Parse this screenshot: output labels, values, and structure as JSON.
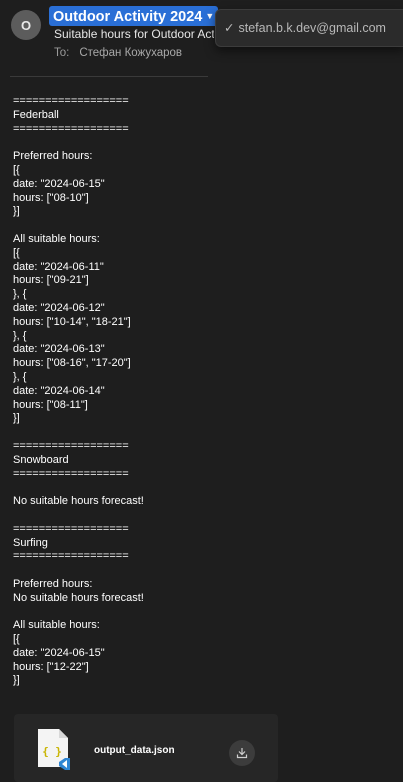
{
  "header": {
    "avatar_initial": "O",
    "sender_name": "Outdoor Activity 2024",
    "subject": "Suitable hours for Outdoor Activities",
    "to_label": "To:",
    "to_name": "Стефан Кожухаров"
  },
  "popup": {
    "account": "stefan.b.k.dev@gmail.com"
  },
  "body_lines": [
    "==================",
    "Federball",
    "==================",
    "",
    "Preferred hours:",
    "[{",
    "date: \"2024-06-15\"",
    "hours: [\"08-10\"]",
    "}]",
    "",
    "All suitable hours:",
    "[{",
    "date: \"2024-06-11\"",
    "hours: [\"09-21\"]",
    "}, {",
    "date: \"2024-06-12\"",
    "hours: [\"10-14\", \"18-21\"]",
    "}, {",
    "date: \"2024-06-13\"",
    "hours: [\"08-16\", \"17-20\"]",
    "}, {",
    "date: \"2024-06-14\"",
    "hours: [\"08-11\"]",
    "}]",
    "",
    "==================",
    "Snowboard",
    "==================",
    "",
    "No suitable hours forecast!",
    "",
    "==================",
    "Surfing",
    "==================",
    "",
    "Preferred hours:",
    "No suitable hours forecast!",
    "",
    "All suitable hours:",
    "[{",
    "date: \"2024-06-15\"",
    "hours: [\"12-22\"]",
    "}]"
  ],
  "attachment": {
    "file_name": "output_data.json",
    "icon_glyph": "{ }",
    "icon": "json-file-icon",
    "download_icon": "download-icon"
  },
  "colors": {
    "background": "#1e1e1e",
    "accent": "#2a6fd6",
    "json_glyph": "#c8b400",
    "vscode_badge": "#2f86d3"
  }
}
